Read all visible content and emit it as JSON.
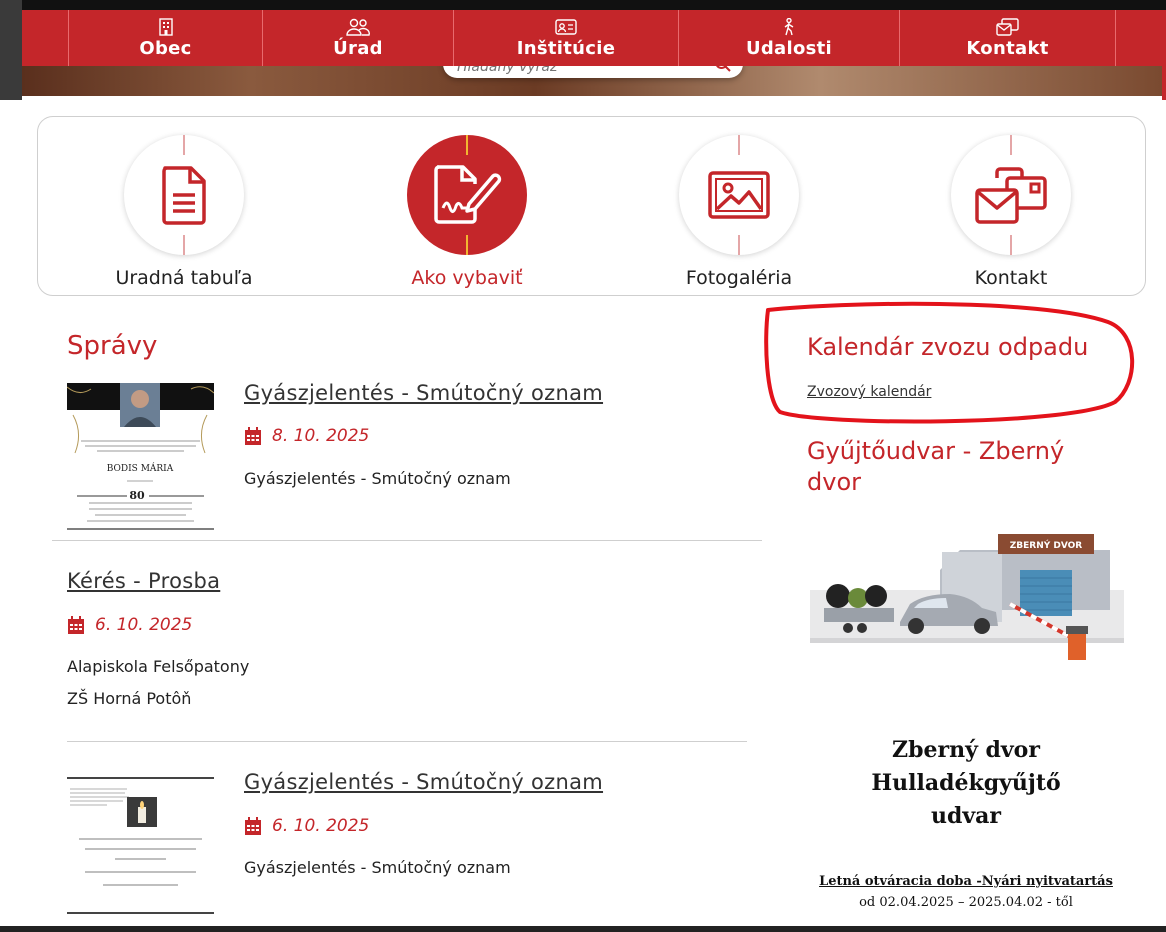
{
  "nav": {
    "items": [
      {
        "label": "Obec",
        "icon": "building-icon"
      },
      {
        "label": "Úrad",
        "icon": "people-icon"
      },
      {
        "label": "Inštitúcie",
        "icon": "id-card-icon"
      },
      {
        "label": "Udalosti",
        "icon": "walking-person-icon"
      },
      {
        "label": "Kontakt",
        "icon": "contact-card-icon"
      }
    ]
  },
  "search": {
    "placeholder": "Hľadaný výraz"
  },
  "quick_links": [
    {
      "label": "Uradná tabuľa",
      "icon": "document-icon",
      "active": false
    },
    {
      "label": "Ako vybaviť",
      "icon": "signed-document-icon",
      "active": true
    },
    {
      "label": "Fotogaléria",
      "icon": "image-icon",
      "active": false
    },
    {
      "label": "Kontakt",
      "icon": "mail-card-icon",
      "active": false
    }
  ],
  "news": {
    "title": "Správy",
    "items": [
      {
        "title": "Gyászjelentés - Smútočný oznam",
        "date": "8. 10. 2025",
        "text": "Gyászjelentés - Smútočný oznam"
      },
      {
        "title": "Kérés - Prosba",
        "date": "6. 10. 2025",
        "text_lines": [
          "Alapiskola Felsőpatony",
          "ZŠ Horná Potôň"
        ]
      },
      {
        "title": "Gyászjelentés - Smútočný oznam",
        "date": "6. 10. 2025",
        "text": "Gyászjelentés - Smútočný oznam"
      }
    ],
    "thumb1": {
      "name": "BODIS MÁRIA",
      "age": "80"
    }
  },
  "sidebar": {
    "waste_title": "Kalendár zvozu odpadu",
    "waste_link": "Zvozový kalendár",
    "yard_title": "Gyűjtőudvar - Zberný dvor",
    "yard_sign": "ZBERNÝ DVOR",
    "poster_lines": [
      "Zberný dvor",
      "Hulladékgyűjtő",
      "udvar"
    ],
    "poster_hours": "Letná otváracia doba -Nyári nyitvatartás",
    "poster_from": "od 02.04.2025 – 2025.04.02 - től"
  },
  "colors": {
    "brand": "#c4262a",
    "annotation": "#e3131b"
  }
}
